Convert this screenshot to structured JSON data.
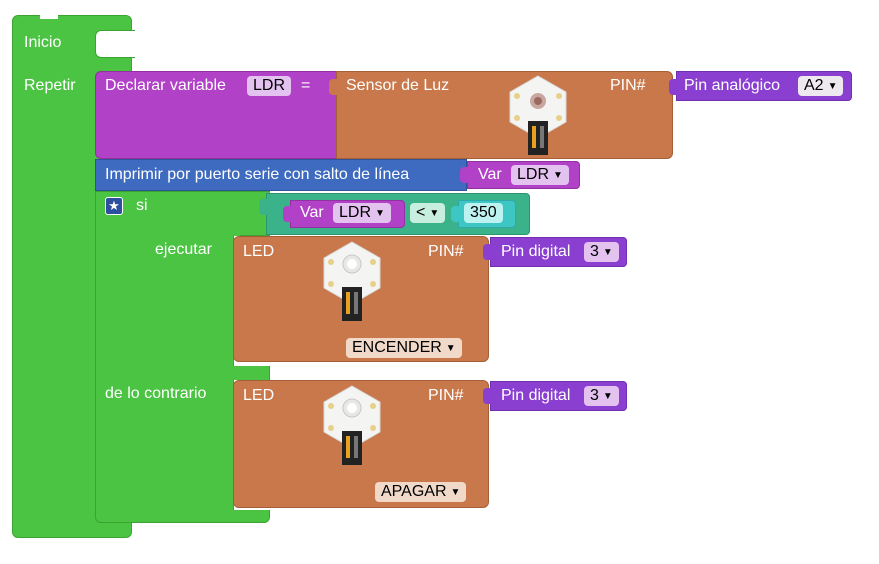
{
  "start_block": {
    "label": "Inicio"
  },
  "loop_block": {
    "label": "Repetir"
  },
  "declare_block": {
    "label": "Declarar variable",
    "variable_name": "LDR",
    "equals": "="
  },
  "light_sensor_block": {
    "label": "Sensor de Luz",
    "pin_label": "PIN#"
  },
  "analog_pin_block": {
    "label": "Pin analógico",
    "value": "A2"
  },
  "print_block": {
    "label": "Imprimir por puerto serie con salto de línea"
  },
  "print_var_block": {
    "label": "Var",
    "value": "LDR"
  },
  "if_block": {
    "if_label": "si",
    "then_label": "ejecutar",
    "else_label": "de lo contrario"
  },
  "compare_block": {
    "var_label": "Var",
    "var_value": "LDR",
    "operator": "<",
    "number": "350"
  },
  "led_on_block": {
    "label": "LED",
    "pin_label": "PIN#",
    "pin_block_label": "Pin digital",
    "pin_value": "3",
    "state": "ENCENDER"
  },
  "led_off_block": {
    "label": "LED",
    "pin_label": "PIN#",
    "pin_block_label": "Pin digital",
    "pin_value": "3",
    "state": "APAGAR"
  },
  "colors": {
    "green": "#4cc443",
    "purple": "#b141c6",
    "orange": "#c8784a",
    "blue": "#3e6bbf",
    "teal": "#3bb38a",
    "violet": "#8a3fd1"
  }
}
